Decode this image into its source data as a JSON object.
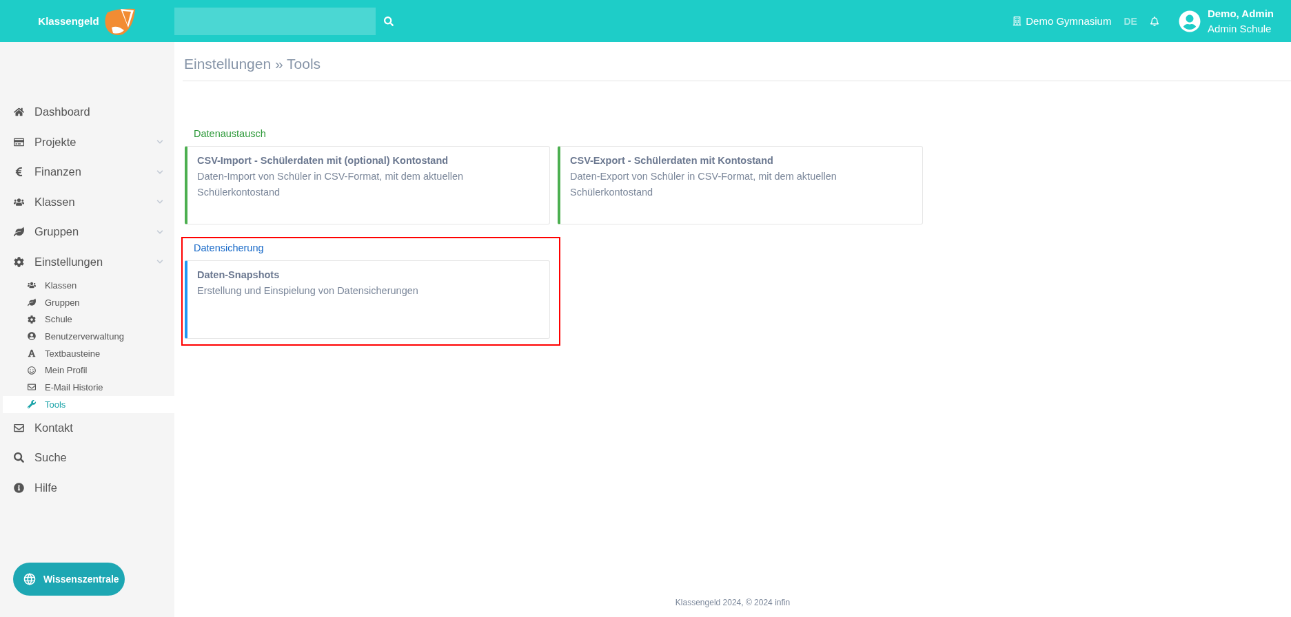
{
  "header": {
    "brand": "Klassengeld",
    "school": "Demo Gymnasium",
    "language": {
      "label": "DE",
      "selected": true
    },
    "user": {
      "name": "Demo, Admin",
      "role": "Admin Schule"
    }
  },
  "sidebar": {
    "items": [
      {
        "label": "Dashboard",
        "kind": "link"
      },
      {
        "label": "Projekte",
        "kind": "group"
      },
      {
        "label": "Finanzen",
        "kind": "group"
      },
      {
        "label": "Klassen",
        "kind": "group"
      },
      {
        "label": "Gruppen",
        "kind": "group"
      },
      {
        "label": "Einstellungen",
        "kind": "group",
        "children": [
          {
            "label": "Klassen",
            "selected": false
          },
          {
            "label": "Gruppen",
            "selected": false
          },
          {
            "label": "Schule",
            "selected": false
          },
          {
            "label": "Benutzerverwaltung",
            "selected": false
          },
          {
            "label": "Textbausteine",
            "selected": false
          },
          {
            "label": "Mein Profil",
            "selected": false
          },
          {
            "label": "E-Mail Historie",
            "selected": false
          },
          {
            "label": "Tools",
            "selected": true
          }
        ]
      },
      {
        "label": "Kontakt",
        "kind": "link"
      },
      {
        "label": "Suche",
        "kind": "link"
      },
      {
        "label": "Hilfe",
        "kind": "link"
      }
    ],
    "help_button": "Wissenszentrale"
  },
  "breadcrumb": "Einstellungen » Tools",
  "sections": [
    {
      "title": "Datenaustausch",
      "color": "#4caf50",
      "highlighted": false,
      "cards": [
        {
          "title": "CSV-Import - Schülerdaten mit (optional) Kontostand",
          "description": "Daten-Import von Schüler in CSV-Format, mit dem aktuellen Schülerkontostand"
        },
        {
          "title": "CSV-Export - Schülerdaten mit Kontostand",
          "description": "Daten-Export von Schüler in CSV-Format, mit dem aktuellen Schülerkontostand"
        }
      ]
    },
    {
      "title": "Datensicherung",
      "color": "#2196f3",
      "highlighted": true,
      "cards": [
        {
          "title": "Daten-Snapshots",
          "description": "Erstellung und Einspielung von Datensicherungen"
        }
      ]
    }
  ],
  "footer": "Klassengeld 2024, © 2024 infin"
}
